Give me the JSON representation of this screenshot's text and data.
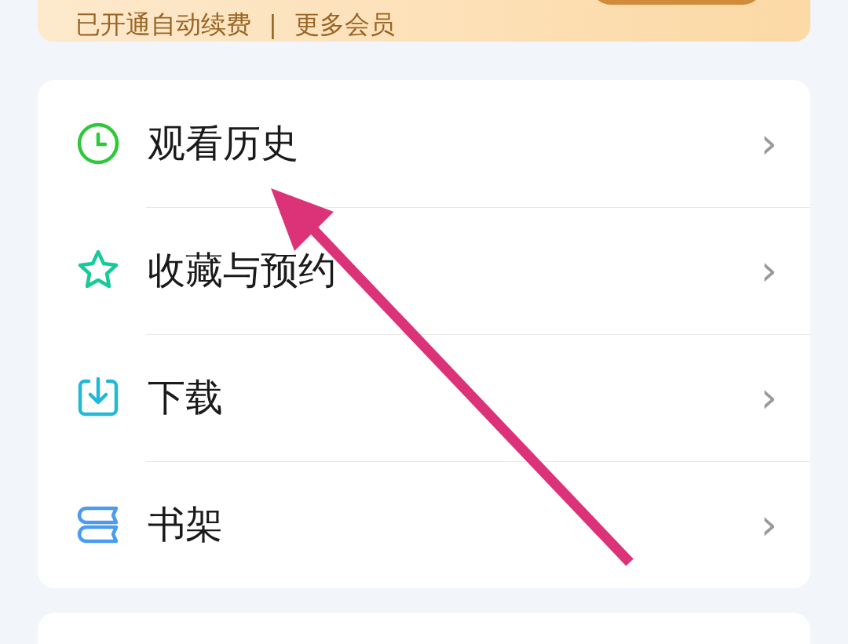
{
  "banner": {
    "status": "已开通自动续费",
    "separator": "|",
    "link": "更多会员"
  },
  "menu": [
    {
      "kind": "history",
      "label": "观看历史",
      "chevron": "›"
    },
    {
      "kind": "favorites",
      "label": "收藏与预约",
      "chevron": "›"
    },
    {
      "kind": "download",
      "label": "下载",
      "chevron": "›"
    },
    {
      "kind": "bookshelf",
      "label": "书架",
      "chevron": "›"
    }
  ]
}
